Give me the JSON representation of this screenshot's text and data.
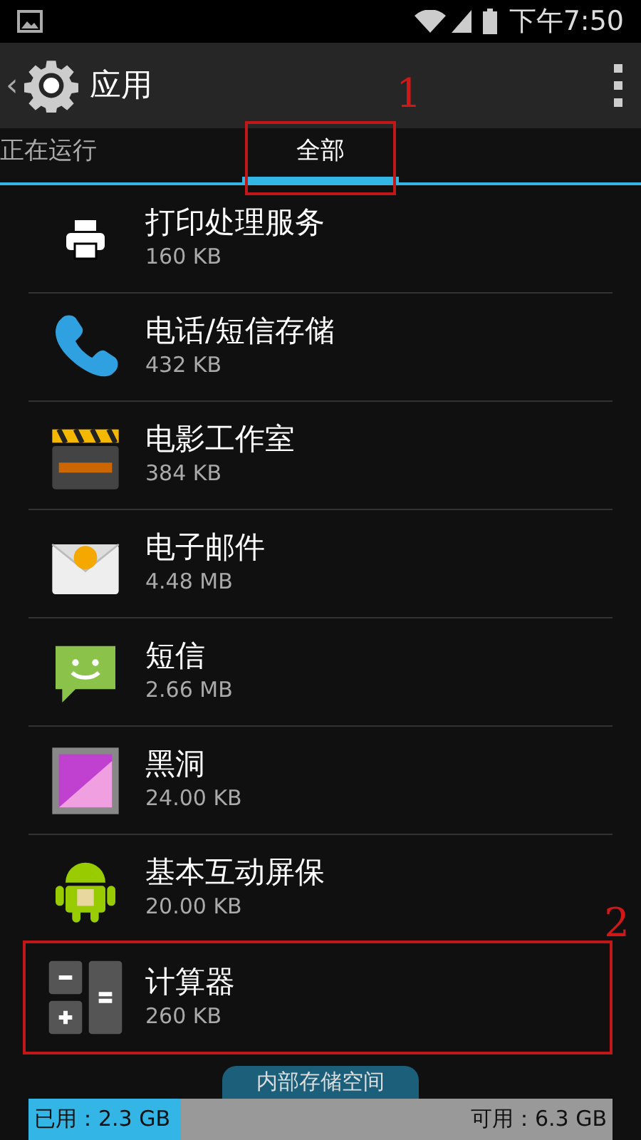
{
  "status_bar": {
    "time": "下午7:50"
  },
  "action_bar": {
    "back": "‹",
    "title": "应用"
  },
  "tabs": [
    {
      "label": "正在运行",
      "selected": false
    },
    {
      "label": "全部",
      "selected": true
    }
  ],
  "apps": [
    {
      "kind": "printer",
      "name": "打印处理服务",
      "size": "160 KB"
    },
    {
      "kind": "phone",
      "name": "电话/短信存储",
      "size": "432 KB"
    },
    {
      "kind": "movie",
      "name": "电影工作室",
      "size": "384 KB"
    },
    {
      "kind": "email",
      "name": "电子邮件",
      "size": "4.48 MB"
    },
    {
      "kind": "sms",
      "name": "短信",
      "size": "2.66 MB"
    },
    {
      "kind": "gallery",
      "name": "黑洞",
      "size": "24.00 KB"
    },
    {
      "kind": "android",
      "name": "基本互动屏保",
      "size": "20.00 KB"
    },
    {
      "kind": "calculator",
      "name": "计算器",
      "size": "260 KB"
    }
  ],
  "storage": {
    "label": "内部存储空间",
    "used": "已用：2.3 GB",
    "free": "可用：6.3 GB",
    "level": 0.26
  },
  "annotations": [
    {
      "kind": "tab",
      "number": "1"
    },
    {
      "kind": "item",
      "number": "2"
    }
  ]
}
